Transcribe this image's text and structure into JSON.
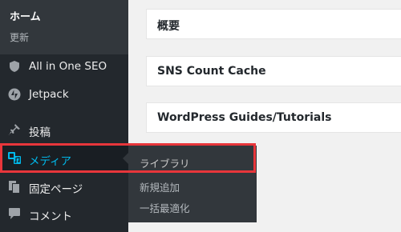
{
  "sidebar": {
    "home": {
      "title": "ホーム",
      "sub": "更新"
    },
    "items": [
      {
        "label": "All in One SEO",
        "icon": "shield-icon"
      },
      {
        "label": "Jetpack",
        "icon": "jetpack-icon"
      },
      {
        "label": "投稿",
        "icon": "pushpin-icon"
      },
      {
        "label": "メディア",
        "icon": "media-icon",
        "active": true
      },
      {
        "label": "固定ページ",
        "icon": "pages-icon"
      },
      {
        "label": "コメント",
        "icon": "comment-icon"
      }
    ]
  },
  "flyout": {
    "items": [
      {
        "label": "ライブラリ"
      },
      {
        "label": "新規追加"
      },
      {
        "label": "一括最適化"
      }
    ]
  },
  "dashboard": {
    "boxes": [
      {
        "title": "概要"
      },
      {
        "title": "SNS Count Cache"
      },
      {
        "title": "WordPress Guides/Tutorials"
      }
    ]
  },
  "colors": {
    "sidebar_bg": "#23282d",
    "accent": "#00b9eb",
    "highlight": "#e8363b"
  }
}
